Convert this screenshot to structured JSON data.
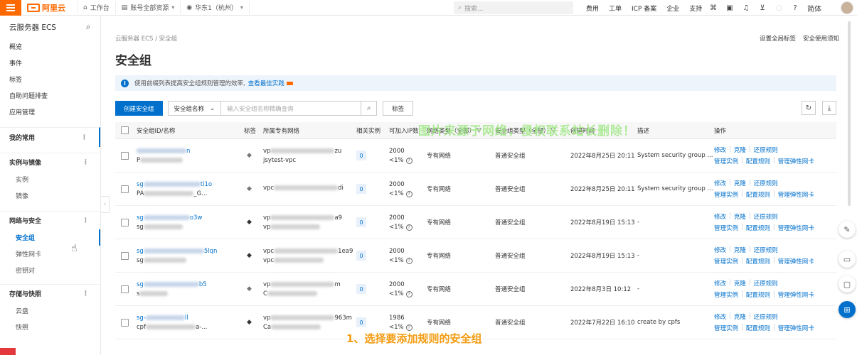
{
  "topbar": {
    "logo_text": "阿里云",
    "workbench": "工作台",
    "account_scope": "账号全部资源",
    "region": "华东1（杭州）",
    "search_placeholder": "搜索...",
    "links": [
      "费用",
      "工单",
      "ICP 备案",
      "企业",
      "支持"
    ],
    "lang": "简体"
  },
  "sidebar": {
    "title": "云服务器 ECS",
    "top_items": [
      "概览",
      "事件",
      "标签",
      "自助问题排查",
      "应用管理"
    ],
    "favorites": "我的常用",
    "groups": [
      {
        "label": "实例与镜像",
        "items": [
          "实例",
          "镜像"
        ]
      },
      {
        "label": "网络与安全",
        "items": [
          "安全组",
          "弹性网卡",
          "密钥对"
        ]
      },
      {
        "label": "存储与快照",
        "items": [
          "云盘",
          "快照"
        ]
      }
    ]
  },
  "main": {
    "breadcrumb": "云服务器 ECS / 安全组",
    "right_links": [
      "设置全局标签",
      "安全使用须知"
    ],
    "title": "安全组",
    "info_text": "使用前缀列表提高安全组规则管理的效率,",
    "info_link": "查看最佳实践",
    "create_btn": "创建安全组",
    "search_field": "安全组名称",
    "search_placeholder": "输入安全组名称精确查询",
    "tag_btn": "标签",
    "columns": [
      "安全组ID/名称",
      "标签",
      "所属专有网络",
      "相关实例",
      "可加入IP数",
      "网络类型（全部）",
      "安全组类型（全部）",
      "创建时间",
      "描述",
      "操作"
    ],
    "rows": [
      {
        "id_end": "n",
        "name_start": "P",
        "vpc_a": "vp",
        "vpc_a_end": "zu",
        "vpc_b": "jsytest-vpc",
        "tag": "light",
        "instances": "0",
        "ip_count": "2000",
        "ip_pct": "<1%",
        "net": "专有网络",
        "type": "普通安全组",
        "time": "2022年8月25日 20:11",
        "desc": "System security group ..."
      },
      {
        "id_start": "sg",
        "id_end": "ti1o",
        "name_start": "PA",
        "name_end": "_G...",
        "vpc_a": "vpc",
        "vpc_a_end": "di",
        "vpc_b": "",
        "tag": "light",
        "instances": "0",
        "ip_count": "2000",
        "ip_pct": "<1%",
        "net": "专有网络",
        "type": "普通安全组",
        "time": "2022年8月25日 20:11",
        "desc": "System security group ..."
      },
      {
        "id_start": "sg",
        "id_end": "o3w",
        "name_start": "sg",
        "vpc_a": "vp",
        "vpc_a_end": "a9",
        "vpc_b": "vp",
        "tag": "dark",
        "instances": "0",
        "ip_count": "2000",
        "ip_pct": "<1%",
        "net": "专有网络",
        "type": "普通安全组",
        "time": "2022年8月19日 15:13",
        "desc": "-"
      },
      {
        "id_start": "sg",
        "id_end": "5lqn",
        "name_start": "sg",
        "vpc_a": "vpc",
        "vpc_a_end": "1ea9",
        "vpc_b": "vpc",
        "tag": "dark",
        "instances": "0",
        "ip_count": "2000",
        "ip_pct": "<1%",
        "net": "专有网络",
        "type": "普通安全组",
        "time": "2022年8月19日 15:13",
        "desc": "-"
      },
      {
        "id_start": "sg",
        "id_end": "b5",
        "name_start": "s",
        "vpc_a": "vp",
        "vpc_a_end": "m",
        "vpc_b": "C",
        "tag": "light",
        "instances": "0",
        "ip_count": "2000",
        "ip_pct": "<1%",
        "net": "专有网络",
        "type": "普通安全组",
        "time": "2022年8月3日 10:12",
        "desc": "-"
      },
      {
        "id_start": "sg-",
        "id_end": "ll",
        "name_start": "cpf",
        "name_end": "a-...",
        "vpc_a": "vp",
        "vpc_a_end": "963m",
        "vpc_b": "Ca",
        "tag": "dark",
        "instances": "0",
        "ip_count": "1986",
        "ip_pct": "<1%",
        "net": "专有网络",
        "type": "普通安全组",
        "time": "2022年7月22日 16:10",
        "desc": "create by cpfs"
      }
    ],
    "ops_line1": [
      "修改",
      "克隆",
      "还原规则"
    ],
    "ops_line2": [
      "管理实例",
      "配置规则",
      "管理弹性网卡"
    ]
  },
  "overlay": {
    "watermark": "图片来源于网络，侵权联系站长删除！",
    "caption": "1、选择要添加规则的安全组"
  }
}
